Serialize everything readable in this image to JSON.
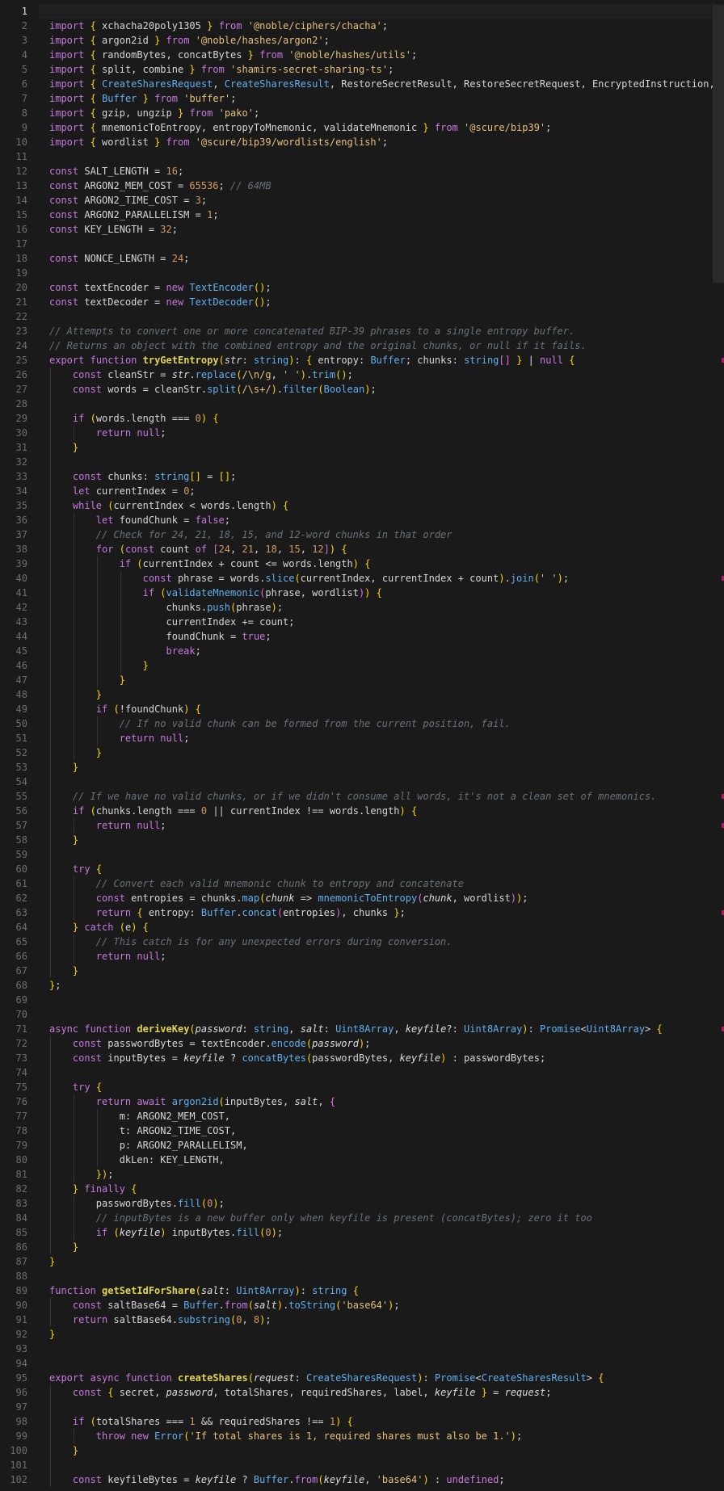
{
  "editor": {
    "language": "typescript",
    "active_line": 1,
    "colors": {
      "background": "#1a1a1a",
      "keyword": "#c678dd",
      "string": "#e5c07b",
      "number": "#d19a66",
      "function": "#e0d44c",
      "comment": "#6b7078",
      "scroll_marker": "#b01a5c"
    },
    "lines": [
      "",
      "import { xchacha20poly1305 } from '@noble/ciphers/chacha';",
      "import { argon2id } from '@noble/hashes/argon2';",
      "import { randomBytes, concatBytes } from '@noble/hashes/utils';",
      "import { split, combine } from 'shamirs-secret-sharing-ts';",
      "import { CreateSharesRequest, CreateSharesResult, RestoreSecretResult, RestoreSecretRequest, EncryptedInstruction, D",
      "import { Buffer } from 'buffer';",
      "import { gzip, ungzip } from 'pako';",
      "import { mnemonicToEntropy, entropyToMnemonic, validateMnemonic } from '@scure/bip39';",
      "import { wordlist } from '@scure/bip39/wordlists/english';",
      "",
      "const SALT_LENGTH = 16;",
      "const ARGON2_MEM_COST = 65536; // 64MB",
      "const ARGON2_TIME_COST = 3;",
      "const ARGON2_PARALLELISM = 1;",
      "const KEY_LENGTH = 32;",
      "",
      "const NONCE_LENGTH = 24;",
      "",
      "const textEncoder = new TextEncoder();",
      "const textDecoder = new TextDecoder();",
      "",
      "// Attempts to convert one or more concatenated BIP-39 phrases to a single entropy buffer.",
      "// Returns an object with the combined entropy and the original chunks, or null if it fails.",
      "export function tryGetEntropy(str: string): { entropy: Buffer; chunks: string[] } | null {",
      "    const cleanStr = str.replace(/\\n/g, ' ').trim();",
      "    const words = cleanStr.split(/\\s+/).filter(Boolean);",
      "",
      "    if (words.length === 0) {",
      "        return null;",
      "    }",
      "",
      "    const chunks: string[] = [];",
      "    let currentIndex = 0;",
      "    while (currentIndex < words.length) {",
      "        let foundChunk = false;",
      "        // Check for 24, 21, 18, 15, and 12-word chunks in that order",
      "        for (const count of [24, 21, 18, 15, 12]) {",
      "            if (currentIndex + count <= words.length) {",
      "                const phrase = words.slice(currentIndex, currentIndex + count).join(' ');",
      "                if (validateMnemonic(phrase, wordlist)) {",
      "                    chunks.push(phrase);",
      "                    currentIndex += count;",
      "                    foundChunk = true;",
      "                    break;",
      "                }",
      "            }",
      "        }",
      "        if (!foundChunk) {",
      "            // If no valid chunk can be formed from the current position, fail.",
      "            return null;",
      "        }",
      "    }",
      "",
      "    // If we have no valid chunks, or if we didn't consume all words, it's not a clean set of mnemonics.",
      "    if (chunks.length === 0 || currentIndex !== words.length) {",
      "        return null;",
      "    }",
      "",
      "    try {",
      "        // Convert each valid mnemonic chunk to entropy and concatenate",
      "        const entropies = chunks.map(chunk => mnemonicToEntropy(chunk, wordlist));",
      "        return { entropy: Buffer.concat(entropies), chunks };",
      "    } catch (e) {",
      "        // This catch is for any unexpected errors during conversion.",
      "        return null;",
      "    }",
      "};",
      "",
      "",
      "async function deriveKey(password: string, salt: Uint8Array, keyfile?: Uint8Array): Promise<Uint8Array> {",
      "    const passwordBytes = textEncoder.encode(password);",
      "    const inputBytes = keyfile ? concatBytes(passwordBytes, keyfile) : passwordBytes;",
      "",
      "    try {",
      "        return await argon2id(inputBytes, salt, {",
      "            m: ARGON2_MEM_COST,",
      "            t: ARGON2_TIME_COST,",
      "            p: ARGON2_PARALLELISM,",
      "            dkLen: KEY_LENGTH,",
      "        });",
      "    } finally {",
      "        passwordBytes.fill(0);",
      "        // inputBytes is a new buffer only when keyfile is present (concatBytes); zero it too",
      "        if (keyfile) inputBytes.fill(0);",
      "    }",
      "}",
      "",
      "function getSetIdForShare(salt: Uint8Array): string {",
      "    const saltBase64 = Buffer.from(salt).toString('base64');",
      "    return saltBase64.substring(0, 8);",
      "}",
      "",
      "",
      "export async function createShares(request: CreateSharesRequest): Promise<CreateSharesResult> {",
      "    const { secret, password, totalShares, requiredShares, label, keyfile } = request;",
      "",
      "    if (totalShares === 1 && requiredShares !== 1) {",
      "        throw new Error('If total shares is 1, required shares must also be 1.');",
      "    }",
      "",
      "    const keyfileBytes = keyfile ? Buffer.from(keyfile, 'base64') : undefined;"
    ],
    "scroll_markers_lines": [
      25,
      40,
      55,
      57,
      63,
      71
    ]
  }
}
